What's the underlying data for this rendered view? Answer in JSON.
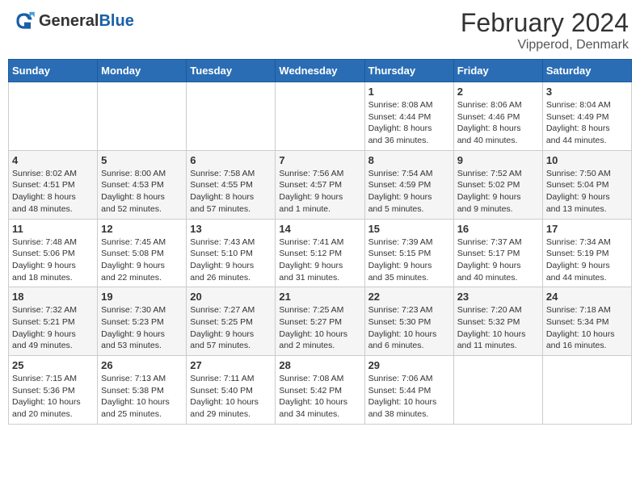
{
  "header": {
    "logo_general": "General",
    "logo_blue": "Blue",
    "title": "February 2024",
    "subtitle": "Vipperod, Denmark"
  },
  "weekdays": [
    "Sunday",
    "Monday",
    "Tuesday",
    "Wednesday",
    "Thursday",
    "Friday",
    "Saturday"
  ],
  "weeks": [
    [
      {
        "day": "",
        "info": ""
      },
      {
        "day": "",
        "info": ""
      },
      {
        "day": "",
        "info": ""
      },
      {
        "day": "",
        "info": ""
      },
      {
        "day": "1",
        "info": "Sunrise: 8:08 AM\nSunset: 4:44 PM\nDaylight: 8 hours\nand 36 minutes."
      },
      {
        "day": "2",
        "info": "Sunrise: 8:06 AM\nSunset: 4:46 PM\nDaylight: 8 hours\nand 40 minutes."
      },
      {
        "day": "3",
        "info": "Sunrise: 8:04 AM\nSunset: 4:49 PM\nDaylight: 8 hours\nand 44 minutes."
      }
    ],
    [
      {
        "day": "4",
        "info": "Sunrise: 8:02 AM\nSunset: 4:51 PM\nDaylight: 8 hours\nand 48 minutes."
      },
      {
        "day": "5",
        "info": "Sunrise: 8:00 AM\nSunset: 4:53 PM\nDaylight: 8 hours\nand 52 minutes."
      },
      {
        "day": "6",
        "info": "Sunrise: 7:58 AM\nSunset: 4:55 PM\nDaylight: 8 hours\nand 57 minutes."
      },
      {
        "day": "7",
        "info": "Sunrise: 7:56 AM\nSunset: 4:57 PM\nDaylight: 9 hours\nand 1 minute."
      },
      {
        "day": "8",
        "info": "Sunrise: 7:54 AM\nSunset: 4:59 PM\nDaylight: 9 hours\nand 5 minutes."
      },
      {
        "day": "9",
        "info": "Sunrise: 7:52 AM\nSunset: 5:02 PM\nDaylight: 9 hours\nand 9 minutes."
      },
      {
        "day": "10",
        "info": "Sunrise: 7:50 AM\nSunset: 5:04 PM\nDaylight: 9 hours\nand 13 minutes."
      }
    ],
    [
      {
        "day": "11",
        "info": "Sunrise: 7:48 AM\nSunset: 5:06 PM\nDaylight: 9 hours\nand 18 minutes."
      },
      {
        "day": "12",
        "info": "Sunrise: 7:45 AM\nSunset: 5:08 PM\nDaylight: 9 hours\nand 22 minutes."
      },
      {
        "day": "13",
        "info": "Sunrise: 7:43 AM\nSunset: 5:10 PM\nDaylight: 9 hours\nand 26 minutes."
      },
      {
        "day": "14",
        "info": "Sunrise: 7:41 AM\nSunset: 5:12 PM\nDaylight: 9 hours\nand 31 minutes."
      },
      {
        "day": "15",
        "info": "Sunrise: 7:39 AM\nSunset: 5:15 PM\nDaylight: 9 hours\nand 35 minutes."
      },
      {
        "day": "16",
        "info": "Sunrise: 7:37 AM\nSunset: 5:17 PM\nDaylight: 9 hours\nand 40 minutes."
      },
      {
        "day": "17",
        "info": "Sunrise: 7:34 AM\nSunset: 5:19 PM\nDaylight: 9 hours\nand 44 minutes."
      }
    ],
    [
      {
        "day": "18",
        "info": "Sunrise: 7:32 AM\nSunset: 5:21 PM\nDaylight: 9 hours\nand 49 minutes."
      },
      {
        "day": "19",
        "info": "Sunrise: 7:30 AM\nSunset: 5:23 PM\nDaylight: 9 hours\nand 53 minutes."
      },
      {
        "day": "20",
        "info": "Sunrise: 7:27 AM\nSunset: 5:25 PM\nDaylight: 9 hours\nand 57 minutes."
      },
      {
        "day": "21",
        "info": "Sunrise: 7:25 AM\nSunset: 5:27 PM\nDaylight: 10 hours\nand 2 minutes."
      },
      {
        "day": "22",
        "info": "Sunrise: 7:23 AM\nSunset: 5:30 PM\nDaylight: 10 hours\nand 6 minutes."
      },
      {
        "day": "23",
        "info": "Sunrise: 7:20 AM\nSunset: 5:32 PM\nDaylight: 10 hours\nand 11 minutes."
      },
      {
        "day": "24",
        "info": "Sunrise: 7:18 AM\nSunset: 5:34 PM\nDaylight: 10 hours\nand 16 minutes."
      }
    ],
    [
      {
        "day": "25",
        "info": "Sunrise: 7:15 AM\nSunset: 5:36 PM\nDaylight: 10 hours\nand 20 minutes."
      },
      {
        "day": "26",
        "info": "Sunrise: 7:13 AM\nSunset: 5:38 PM\nDaylight: 10 hours\nand 25 minutes."
      },
      {
        "day": "27",
        "info": "Sunrise: 7:11 AM\nSunset: 5:40 PM\nDaylight: 10 hours\nand 29 minutes."
      },
      {
        "day": "28",
        "info": "Sunrise: 7:08 AM\nSunset: 5:42 PM\nDaylight: 10 hours\nand 34 minutes."
      },
      {
        "day": "29",
        "info": "Sunrise: 7:06 AM\nSunset: 5:44 PM\nDaylight: 10 hours\nand 38 minutes."
      },
      {
        "day": "",
        "info": ""
      },
      {
        "day": "",
        "info": ""
      }
    ]
  ]
}
